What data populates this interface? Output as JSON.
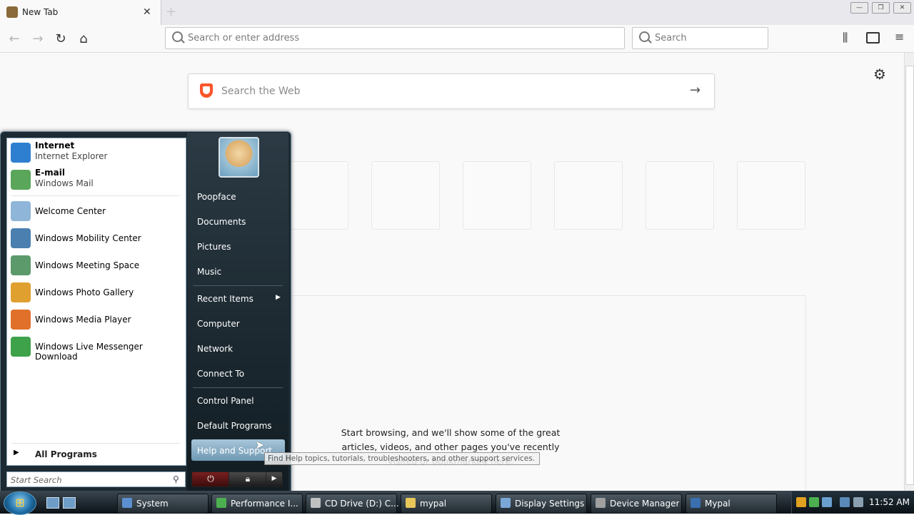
{
  "browser": {
    "tab_title": "New Tab",
    "tab_close": "✕",
    "new_tab": "+",
    "url_placeholder": "Search or enter address",
    "search_placeholder": "Search",
    "window_minimize": "—",
    "window_restore": "❐",
    "window_close": "✕"
  },
  "newtab": {
    "web_search_placeholder": "Search the Web",
    "highlights_empty_text": "Start browsing, and we'll show some of the great articles, videos, and other pages you've recently visited or bookmarked here."
  },
  "start_menu": {
    "pinned": [
      {
        "title": "Internet",
        "subtitle": "Internet Explorer",
        "icon": "internet-explorer-icon",
        "color": "#2f7fd0"
      },
      {
        "title": "E-mail",
        "subtitle": "Windows Mail",
        "icon": "windows-mail-icon",
        "color": "#5aa65a"
      }
    ],
    "recent_programs": [
      {
        "label": "Welcome Center",
        "icon": "welcome-center-icon",
        "color": "#8fb6d8"
      },
      {
        "label": "Windows Mobility Center",
        "icon": "mobility-center-icon",
        "color": "#4a7fb0"
      },
      {
        "label": "Windows Meeting Space",
        "icon": "meeting-space-icon",
        "color": "#5c9a6c"
      },
      {
        "label": "Windows Photo Gallery",
        "icon": "photo-gallery-icon",
        "color": "#e0a030"
      },
      {
        "label": "Windows Media Player",
        "icon": "media-player-icon",
        "color": "#e0702a"
      },
      {
        "label": "Windows Live Messenger Download",
        "icon": "messenger-icon",
        "color": "#3ea24a"
      }
    ],
    "all_programs": "All Programs",
    "search_placeholder": "Start Search",
    "right_items_group1": [
      "Poopface",
      "Documents",
      "Pictures",
      "Music"
    ],
    "recent_items": "Recent Items",
    "right_items_group2": [
      "Computer",
      "Network",
      "Connect To"
    ],
    "right_items_group3": [
      "Control Panel",
      "Default Programs"
    ],
    "help_support": "Help and Support",
    "help_tooltip": "Find Help topics, tutorials, troubleshooters, and other support services."
  },
  "taskbar": {
    "tasks": [
      {
        "label": "System",
        "icon": "system-icon",
        "color": "#5b8fd0"
      },
      {
        "label": "Performance I...",
        "icon": "performance-icon",
        "color": "#4caf50"
      },
      {
        "label": "CD Drive (D:) C...",
        "icon": "cd-drive-icon",
        "color": "#c0c0c0"
      },
      {
        "label": "mypal",
        "icon": "folder-icon",
        "color": "#e8c65a"
      },
      {
        "label": "Display Settings",
        "icon": "display-settings-icon",
        "color": "#7aa7d8"
      },
      {
        "label": "Device Manager",
        "icon": "device-manager-icon",
        "color": "#a0a0a0"
      },
      {
        "label": "Mypal",
        "icon": "mypal-icon",
        "color": "#3a6fb0"
      }
    ],
    "clock": "11:52 AM"
  }
}
